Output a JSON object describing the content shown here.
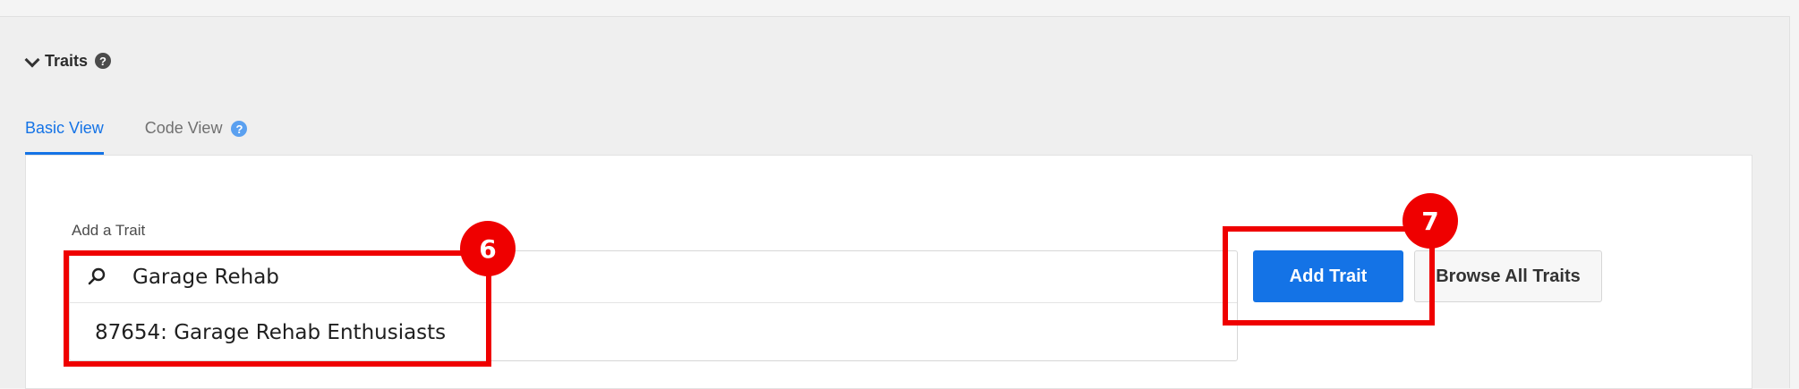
{
  "section": {
    "title": "Traits",
    "help_glyph": "?"
  },
  "tabs": [
    {
      "label": "Basic View",
      "active": true
    },
    {
      "label": "Code View",
      "active": false,
      "help_glyph": "?"
    }
  ],
  "add_trait": {
    "label": "Add a Trait",
    "search_value": "Garage Rehab",
    "suggestion": "87654: Garage Rehab Enthusiasts"
  },
  "buttons": {
    "add_trait": "Add Trait",
    "browse_all": "Browse All Traits"
  },
  "callouts": {
    "step_6": "6",
    "step_7": "7"
  },
  "colors": {
    "accent": "#1473e6",
    "callout": "#ef0000"
  },
  "icons": [
    "chevron-down-icon",
    "help-icon",
    "search-icon"
  ]
}
